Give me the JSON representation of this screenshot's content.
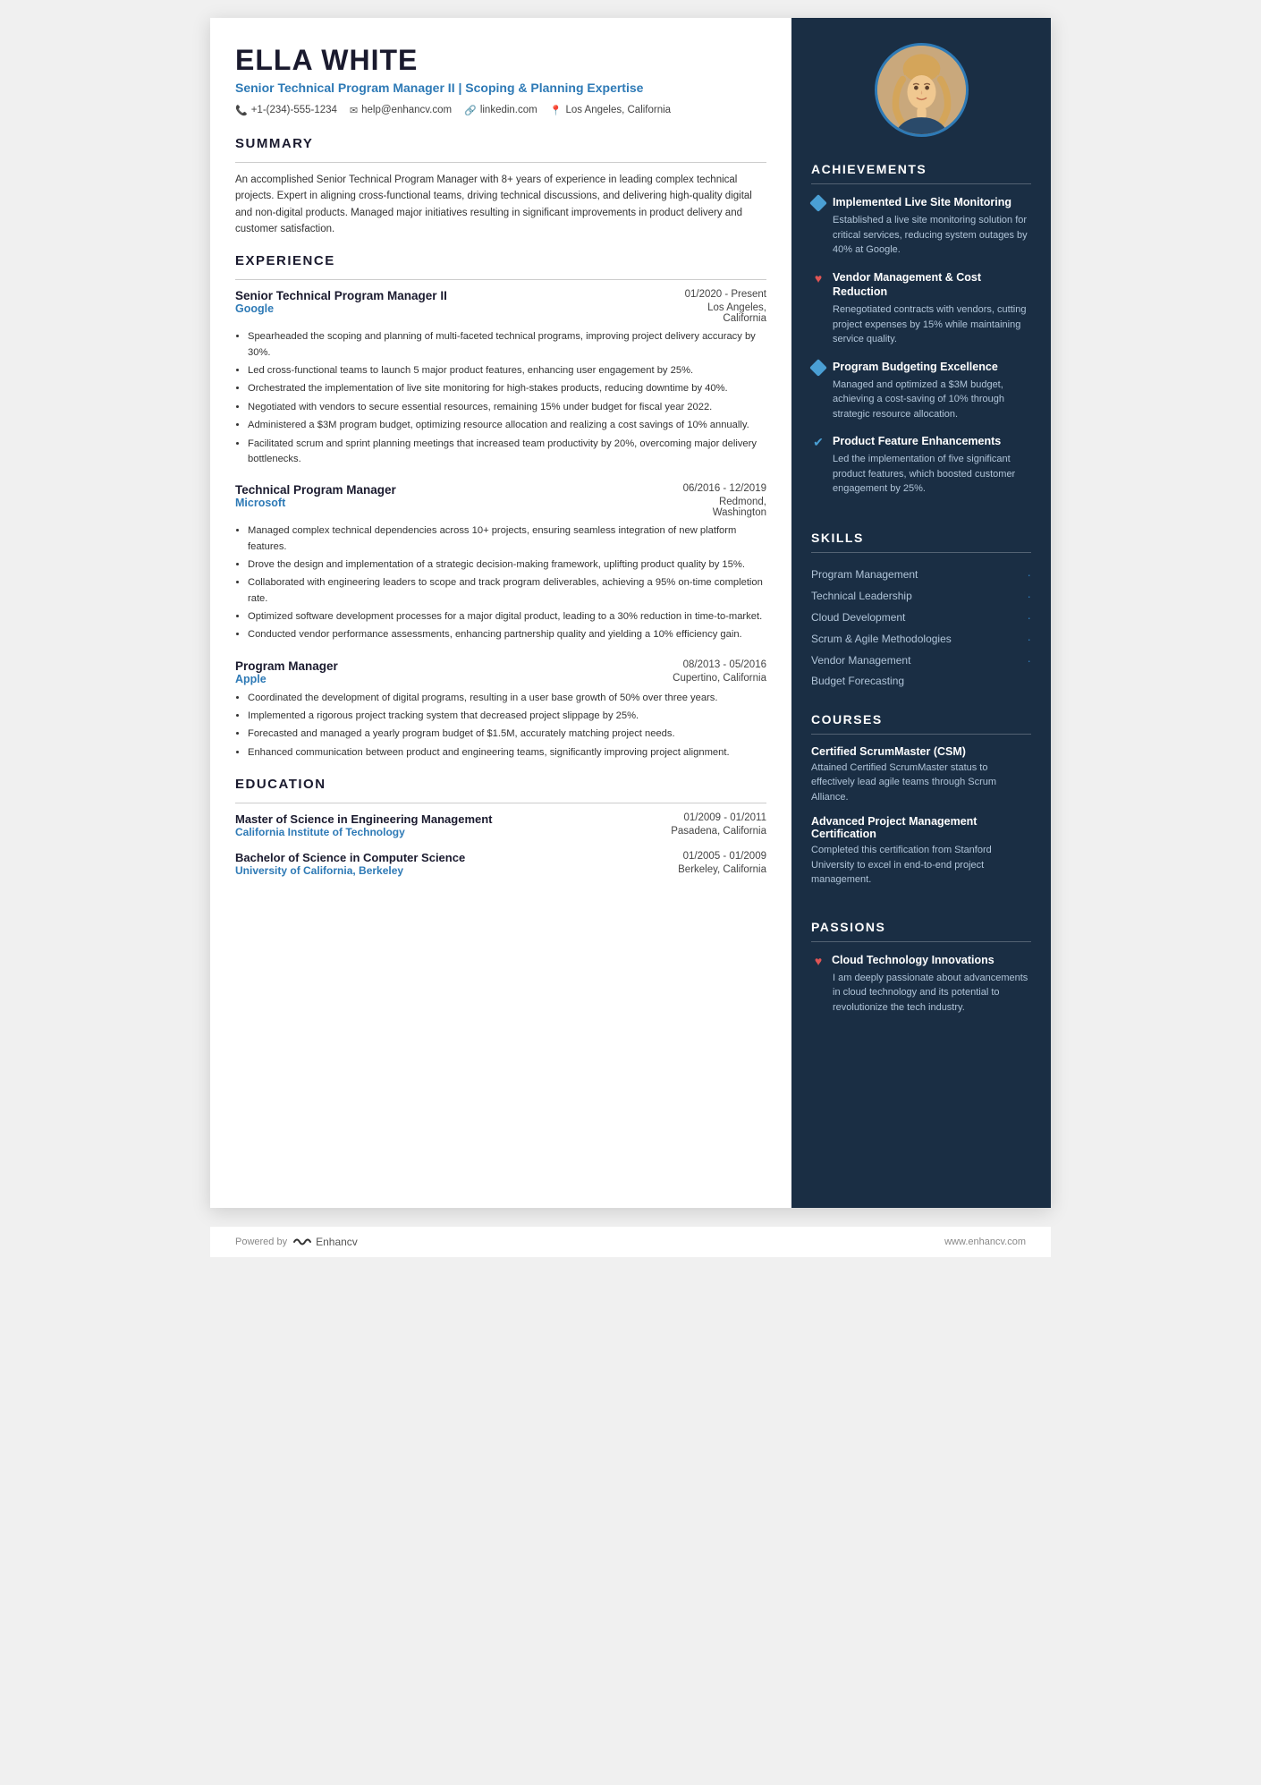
{
  "header": {
    "name": "ELLA WHITE",
    "title": "Senior Technical Program Manager II | Scoping & Planning Expertise",
    "phone": "+1-(234)-555-1234",
    "email": "help@enhancv.com",
    "website": "linkedin.com",
    "location": "Los Angeles, California"
  },
  "summary": {
    "label": "SUMMARY",
    "text": "An accomplished Senior Technical Program Manager with 8+ years of experience in leading complex technical projects. Expert in aligning cross-functional teams, driving technical discussions, and delivering high-quality digital and non-digital products. Managed major initiatives resulting in significant improvements in product delivery and customer satisfaction."
  },
  "experience": {
    "label": "EXPERIENCE",
    "entries": [
      {
        "title": "Senior Technical Program Manager II",
        "dates": "01/2020 - Present",
        "company": "Google",
        "location": "Los Angeles, California",
        "bullets": [
          "Spearheaded the scoping and planning of multi-faceted technical programs, improving project delivery accuracy by 30%.",
          "Led cross-functional teams to launch 5 major product features, enhancing user engagement by 25%.",
          "Orchestrated the implementation of live site monitoring for high-stakes products, reducing downtime by 40%.",
          "Negotiated with vendors to secure essential resources, remaining 15% under budget for fiscal year 2022.",
          "Administered a $3M program budget, optimizing resource allocation and realizing a cost savings of 10% annually.",
          "Facilitated scrum and sprint planning meetings that increased team productivity by 20%, overcoming major delivery bottlenecks."
        ]
      },
      {
        "title": "Technical Program Manager",
        "dates": "06/2016 - 12/2019",
        "company": "Microsoft",
        "location": "Redmond, Washington",
        "bullets": [
          "Managed complex technical dependencies across 10+ projects, ensuring seamless integration of new platform features.",
          "Drove the design and implementation of a strategic decision-making framework, uplifting product quality by 15%.",
          "Collaborated with engineering leaders to scope and track program deliverables, achieving a 95% on-time completion rate.",
          "Optimized software development processes for a major digital product, leading to a 30% reduction in time-to-market.",
          "Conducted vendor performance assessments, enhancing partnership quality and yielding a 10% efficiency gain."
        ]
      },
      {
        "title": "Program Manager",
        "dates": "08/2013 - 05/2016",
        "company": "Apple",
        "location": "Cupertino, California",
        "bullets": [
          "Coordinated the development of digital programs, resulting in a user base growth of 50% over three years.",
          "Implemented a rigorous project tracking system that decreased project slippage by 25%.",
          "Forecasted and managed a yearly program budget of $1.5M, accurately matching project needs.",
          "Enhanced communication between product and engineering teams, significantly improving project alignment."
        ]
      }
    ]
  },
  "education": {
    "label": "EDUCATION",
    "entries": [
      {
        "degree": "Master of Science in Engineering Management",
        "dates": "01/2009 - 01/2011",
        "school": "California Institute of Technology",
        "location": "Pasadena, California"
      },
      {
        "degree": "Bachelor of Science in Computer Science",
        "dates": "01/2005 - 01/2009",
        "school": "University of California, Berkeley",
        "location": "Berkeley, California"
      }
    ]
  },
  "achievements": {
    "label": "ACHIEVEMENTS",
    "items": [
      {
        "icon": "diamond",
        "title": "Implemented Live Site Monitoring",
        "desc": "Established a live site monitoring solution for critical services, reducing system outages by 40% at Google."
      },
      {
        "icon": "heart",
        "title": "Vendor Management & Cost Reduction",
        "desc": "Renegotiated contracts with vendors, cutting project expenses by 15% while maintaining service quality."
      },
      {
        "icon": "diamond",
        "title": "Program Budgeting Excellence",
        "desc": "Managed and optimized a $3M budget, achieving a cost-saving of 10% through strategic resource allocation."
      },
      {
        "icon": "check",
        "title": "Product Feature Enhancements",
        "desc": "Led the implementation of five significant product features, which boosted customer engagement by 25%."
      }
    ]
  },
  "skills": {
    "label": "SKILLS",
    "items": [
      "Program Management",
      "Technical Leadership",
      "Cloud Development",
      "Scrum & Agile Methodologies",
      "Vendor Management",
      "Budget Forecasting"
    ]
  },
  "courses": {
    "label": "COURSES",
    "items": [
      {
        "title": "Certified ScrumMaster (CSM)",
        "desc": "Attained Certified ScrumMaster status to effectively lead agile teams through Scrum Alliance."
      },
      {
        "title": "Advanced Project Management Certification",
        "desc": "Completed this certification from Stanford University to excel in end-to-end project management."
      }
    ]
  },
  "passions": {
    "label": "PASSIONS",
    "items": [
      {
        "icon": "heart",
        "title": "Cloud Technology Innovations",
        "desc": "I am deeply passionate about advancements in cloud technology and its potential to revolutionize the tech industry."
      }
    ]
  },
  "footer": {
    "powered_by": "Powered by",
    "brand": "Enhancv",
    "website": "www.enhancv.com"
  }
}
